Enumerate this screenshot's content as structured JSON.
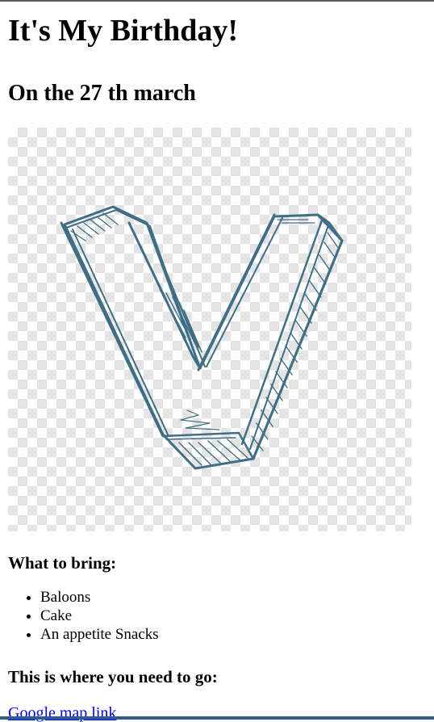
{
  "header": {
    "title": "It's My Birthday!",
    "subtitle": "On the 27 th march"
  },
  "image": {
    "icon": "vuetify-v-logo-sketch",
    "stroke_color": "#3f6e85",
    "checker_color": "#e4e4e4"
  },
  "bring": {
    "heading": "What to bring:",
    "items": [
      "Baloons",
      "Cake",
      "An appetite Snacks"
    ]
  },
  "location": {
    "heading": "This is where you need to go:",
    "link_label": "Google map link"
  },
  "colors": {
    "link": "#0000ee",
    "bottom_bar": "#2f5d8a"
  }
}
